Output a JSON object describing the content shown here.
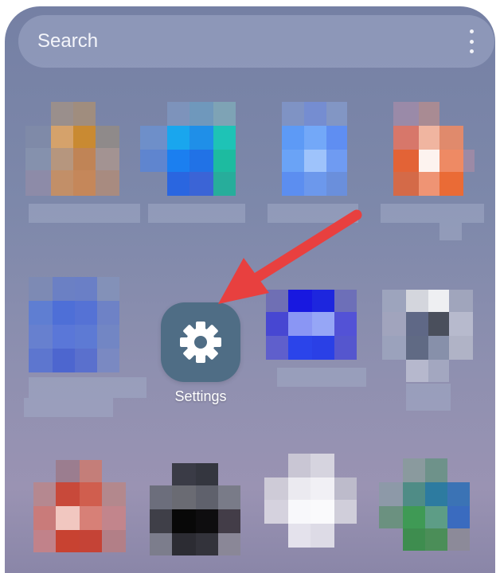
{
  "search": {
    "label": "Search",
    "more_icon": "more-vertical-icon"
  },
  "apps": {
    "settings": {
      "label": "Settings",
      "icon": "gear-icon",
      "tile_color": "#4f6d85"
    }
  },
  "annotation": {
    "type": "arrow",
    "color": "#e8403f",
    "points_to": "settings"
  }
}
